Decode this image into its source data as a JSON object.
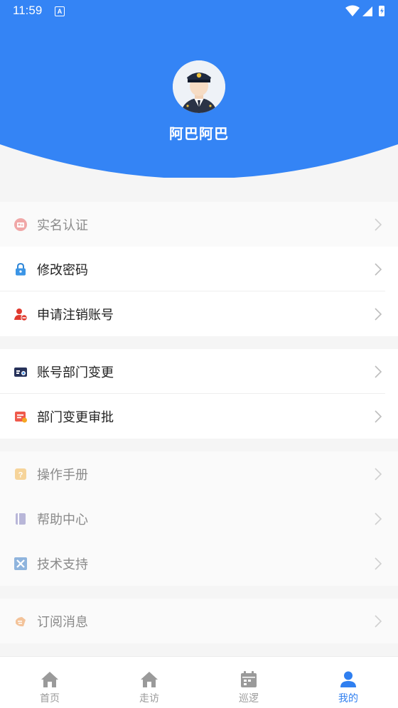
{
  "status_bar": {
    "time": "11:59",
    "notice_badge": "A"
  },
  "profile": {
    "name": "阿巴阿巴"
  },
  "menu_groups": [
    [
      {
        "label": "实名认证",
        "icon": "id-card-icon",
        "dim": true
      },
      {
        "label": "修改密码",
        "icon": "lock-icon"
      },
      {
        "label": "申请注销账号",
        "icon": "user-remove-icon"
      }
    ],
    [
      {
        "label": "账号部门变更",
        "icon": "department-card-icon"
      },
      {
        "label": "部门变更审批",
        "icon": "approval-icon"
      }
    ],
    [
      {
        "label": "操作手册",
        "icon": "manual-icon"
      },
      {
        "label": "帮助中心",
        "icon": "help-book-icon"
      },
      {
        "label": "技术支持",
        "icon": "tools-icon"
      }
    ],
    [
      {
        "label": "订阅消息",
        "icon": "subscribe-icon"
      }
    ]
  ],
  "tabs": [
    {
      "label": "首页",
      "icon": "home-icon"
    },
    {
      "label": "走访",
      "icon": "home-icon"
    },
    {
      "label": "巡逻",
      "icon": "calendar-icon"
    },
    {
      "label": "我的",
      "icon": "user-icon",
      "active": true
    }
  ],
  "colors": {
    "primary": "#3484f5",
    "tab_active": "#2f7ff0",
    "tab_inactive": "#9a9a9a"
  }
}
